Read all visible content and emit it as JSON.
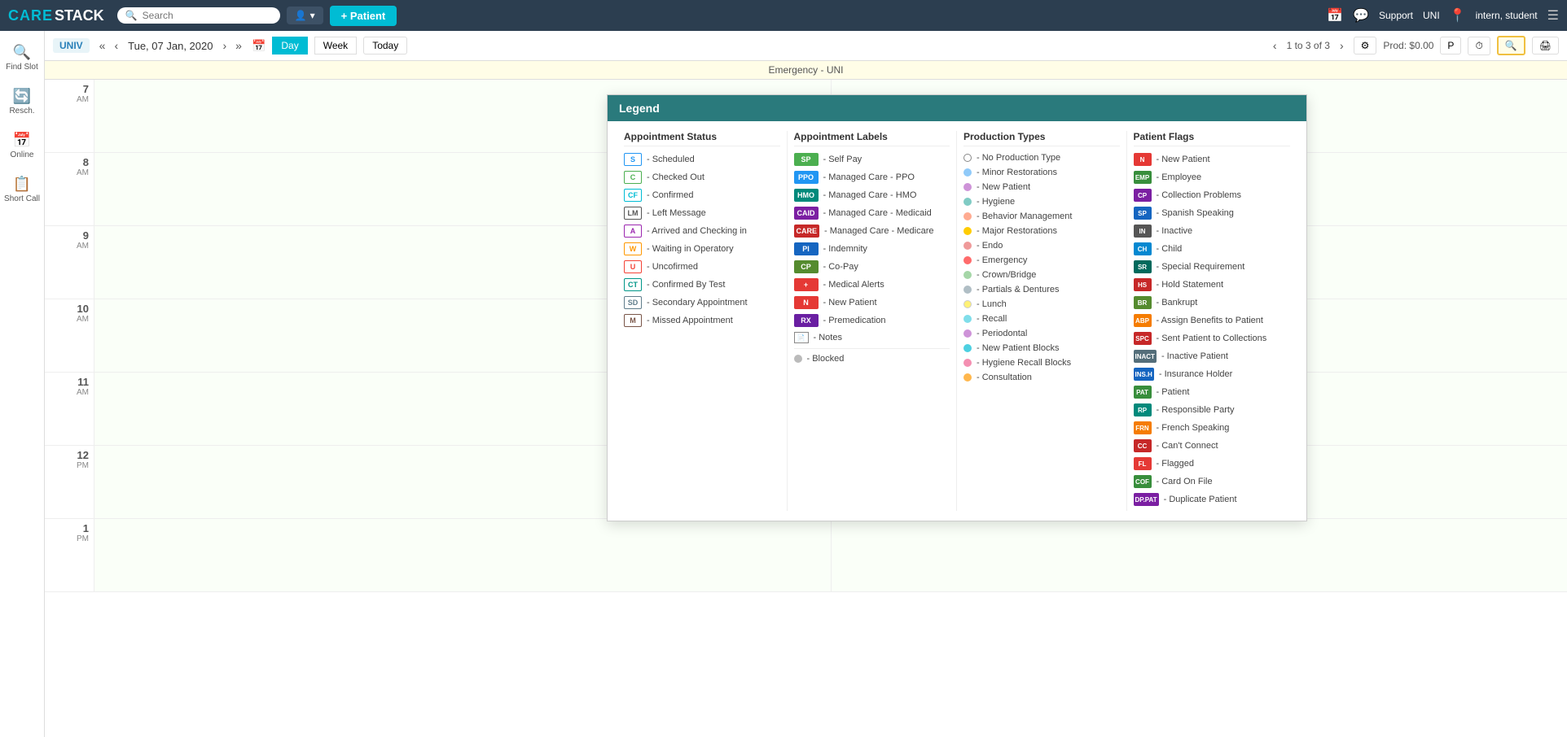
{
  "navbar": {
    "logo_care": "CARE",
    "logo_stack": "STACK",
    "search_placeholder": "Search",
    "user_label": "▾",
    "add_patient_label": "+ Patient",
    "calendar_icon": "📅",
    "chat_icon": "💬",
    "support_label": "Support",
    "uni_label": "UNI",
    "location_icon": "📍",
    "user_name": "intern, student",
    "menu_icon": "☰"
  },
  "toolbar": {
    "location": "UNIV",
    "prev_prev": "«",
    "prev": "‹",
    "date_label": "Tue,  07 Jan, 2020",
    "next": "›",
    "next_next": "»",
    "calendar_icon": "📅",
    "day_label": "Day",
    "week_label": "Week",
    "today_label": "Today",
    "pagination": "1 to 3 of 3",
    "prev_page": "‹",
    "next_page": "›",
    "settings_icon": "⚙",
    "prod_label": "Prod: $0.00",
    "p_btn": "P",
    "clock_btn": "⏱",
    "search_btn": "🔍",
    "print_btn": "🖨"
  },
  "emergency_banner": "Emergency - UNI",
  "sidebar": {
    "items": [
      {
        "icon": "🔍",
        "label": "Find Slot"
      },
      {
        "icon": "🔄",
        "label": "Resch."
      },
      {
        "icon": "📅",
        "label": "Online"
      },
      {
        "icon": "📋",
        "label": "Short Call"
      }
    ]
  },
  "time_slots": [
    {
      "hour": "7",
      "ampm": "AM"
    },
    {
      "hour": "8",
      "ampm": "AM"
    },
    {
      "hour": "9",
      "ampm": "AM"
    },
    {
      "hour": "10",
      "ampm": "AM"
    },
    {
      "hour": "11",
      "ampm": "AM"
    },
    {
      "hour": "12",
      "ampm": "PM"
    },
    {
      "hour": "1",
      "ampm": "PM"
    }
  ],
  "legend": {
    "title": "Legend",
    "columns": {
      "appointment_status": {
        "header": "Appointment Status",
        "items": [
          {
            "badge": "S",
            "badge_color": "#2196f3",
            "label": "Scheduled"
          },
          {
            "badge": "C",
            "badge_color": "#4caf50",
            "label": "Checked Out"
          },
          {
            "badge": "CF",
            "badge_color": "#00bcd4",
            "label": "Confirmed"
          },
          {
            "badge": "LM",
            "badge_color": "#555",
            "label": "Left Message"
          },
          {
            "badge": "A",
            "badge_color": "#9c27b0",
            "label": "Arrived and Checking in"
          },
          {
            "badge": "W",
            "badge_color": "#ff9800",
            "label": "Waiting in Operatory"
          },
          {
            "badge": "U",
            "badge_color": "#f44336",
            "label": "Uncofirmed"
          },
          {
            "badge": "CT",
            "badge_color": "#009688",
            "label": "Confirmed By Test"
          },
          {
            "badge": "SD",
            "badge_color": "#607d8b",
            "label": "Secondary Appointment"
          },
          {
            "badge": "M",
            "badge_color": "#795548",
            "label": "Missed Appointment"
          }
        ]
      },
      "appointment_labels": {
        "header": "Appointment Labels",
        "items": [
          {
            "badge": "SP",
            "bg": "#4caf50",
            "label": "Self Pay"
          },
          {
            "badge": "PPO",
            "bg": "#2196f3",
            "label": "Managed Care - PPO"
          },
          {
            "badge": "HMO",
            "bg": "#00897b",
            "label": "Managed Care - HMO"
          },
          {
            "badge": "CAID",
            "bg": "#7b1fa2",
            "label": "Managed Care - Medicaid"
          },
          {
            "badge": "CARE",
            "bg": "#c62828",
            "label": "Managed Care - Medicare"
          },
          {
            "badge": "PI",
            "bg": "#1565c0",
            "label": "Indemnity"
          },
          {
            "badge": "CP",
            "bg": "#558b2f",
            "label": "Co-Pay"
          },
          {
            "badge": "+",
            "bg": "#e53935",
            "label": "Medical Alerts"
          },
          {
            "badge": "N",
            "bg": "#e53935",
            "label": "New Patient"
          },
          {
            "badge": "RX",
            "bg": "#6a1fa2",
            "label": "Premedication"
          },
          {
            "type": "notes",
            "label": "Notes"
          },
          {
            "type": "separator"
          },
          {
            "type": "blocked",
            "label": "Blocked"
          }
        ]
      },
      "production_types": {
        "header": "Production Types",
        "items": [
          {
            "type": "dot_outline",
            "label": "No Production Type"
          },
          {
            "dot_color": "#90caf9",
            "label": "Minor Restorations"
          },
          {
            "dot_color": "#ce93d8",
            "label": "New Patient"
          },
          {
            "dot_color": "#80cbc4",
            "label": "Hygiene"
          },
          {
            "dot_color": "#ffab91",
            "label": "Behavior Management"
          },
          {
            "dot_color": "#ffcc02",
            "label": "Major Restorations"
          },
          {
            "dot_color": "#ef9a9a",
            "label": "Endo"
          },
          {
            "dot_color": "#ff6b6b",
            "label": "Emergency"
          },
          {
            "dot_color": "#a5d6a7",
            "label": "Crown/Bridge"
          },
          {
            "dot_color": "#b0bec5",
            "label": "Partials & Dentures"
          },
          {
            "dot_color": "#fff176",
            "label": "Lunch"
          },
          {
            "dot_color": "#80deea",
            "label": "Recall"
          },
          {
            "dot_color": "#ce93d8",
            "label": "Periodontal"
          },
          {
            "dot_color": "#4dd0e1",
            "label": "New Patient Blocks"
          },
          {
            "dot_color": "#f48fb1",
            "label": "Hygiene Recall Blocks"
          },
          {
            "dot_color": "#ffb74d",
            "label": "Consultation"
          }
        ]
      },
      "patient_flags": {
        "header": "Patient Flags",
        "items": [
          {
            "badge": "N",
            "bg": "#e53935",
            "label": "New Patient"
          },
          {
            "badge": "EMP",
            "bg": "#388e3c",
            "label": "Employee"
          },
          {
            "badge": "CP",
            "bg": "#7b1fa2",
            "label": "Collection Problems"
          },
          {
            "badge": "SP",
            "bg": "#1565c0",
            "label": "Spanish Speaking"
          },
          {
            "badge": "IN",
            "bg": "#555",
            "label": "Inactive"
          },
          {
            "badge": "CH",
            "bg": "#0288d1",
            "label": "Child"
          },
          {
            "badge": "SR",
            "bg": "#00695c",
            "label": "Special Requirement"
          },
          {
            "badge": "HS",
            "bg": "#c62828",
            "label": "Hold Statement"
          },
          {
            "badge": "BR",
            "bg": "#558b2f",
            "label": "Bankrupt"
          },
          {
            "badge": "ABP",
            "bg": "#f57c00",
            "label": "Assign Benefits to Patient"
          },
          {
            "badge": "SPC",
            "bg": "#c62828",
            "label": "Sent Patient to Collections"
          },
          {
            "badge": "INACT",
            "bg": "#546e7a",
            "label": "Inactive Patient"
          },
          {
            "badge": "INS.H",
            "bg": "#1565c0",
            "label": "Insurance Holder"
          },
          {
            "badge": "PAT",
            "bg": "#388e3c",
            "label": "Patient"
          },
          {
            "badge": "RP",
            "bg": "#00897b",
            "label": "Responsible Party"
          },
          {
            "badge": "FRN",
            "bg": "#f57c00",
            "label": "French Speaking"
          },
          {
            "badge": "CC",
            "bg": "#c62828",
            "label": "Can't Connect"
          },
          {
            "badge": "FL",
            "bg": "#e53935",
            "label": "Flagged"
          },
          {
            "badge": "COF",
            "bg": "#388e3c",
            "label": "Card On File"
          },
          {
            "badge": "DP.PAT",
            "bg": "#7b1fa2",
            "label": "Duplicate Patient"
          }
        ]
      }
    }
  }
}
